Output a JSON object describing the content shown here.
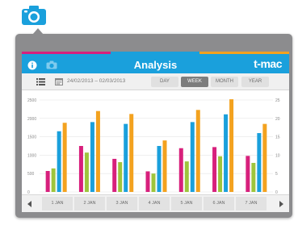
{
  "app": {
    "title": "Analysis",
    "brand": "t-mac",
    "brand_stripes": [
      "#d7207c",
      "#1aa0dc",
      "#f3a21f"
    ],
    "accent": "#1aa0dc"
  },
  "toolbar": {
    "date_range": "24/02/2013 – 02/03/2013",
    "tabs": [
      {
        "label": "DAY",
        "active": false
      },
      {
        "label": "WEEK",
        "active": true
      },
      {
        "label": "MONTH",
        "active": false
      },
      {
        "label": "YEAR",
        "active": false
      }
    ]
  },
  "icons": [
    "camera-icon",
    "info-icon",
    "camera-small-icon",
    "list-icon",
    "calendar-icon",
    "arrow-left-icon",
    "arrow-right-icon"
  ],
  "chart_data": {
    "type": "bar",
    "categories": [
      "1 JAN",
      "2 JAN",
      "3 JAN",
      "4 JAN",
      "5 JAN",
      "6 JAN",
      "7 JAN"
    ],
    "series": [
      {
        "color": "#d7207c",
        "values": [
          570,
          1250,
          900,
          560,
          1190,
          1220,
          980
        ]
      },
      {
        "color": "#9ec53c",
        "values": [
          640,
          1070,
          810,
          500,
          830,
          970,
          790
        ]
      },
      {
        "color": "#1aa0dc",
        "values": [
          1650,
          1900,
          1850,
          1250,
          1900,
          2110,
          1600
        ]
      },
      {
        "color": "#f3a21f",
        "values": [
          1880,
          2200,
          2120,
          1400,
          2230,
          2520,
          1850
        ]
      }
    ],
    "yticks_left": [
      "2500",
      "2000",
      "1500",
      "1000",
      "500",
      "0"
    ],
    "yticks_right": [
      "25",
      "20",
      "15",
      "10",
      "5",
      "0"
    ],
    "ylim": [
      0,
      2500
    ],
    "grid": true
  },
  "pagination": {
    "days": [
      "1 JAN",
      "2 JAN",
      "3 JAN",
      "4 JAN",
      "5 JAN",
      "6 JAN",
      "7 JAN"
    ]
  }
}
